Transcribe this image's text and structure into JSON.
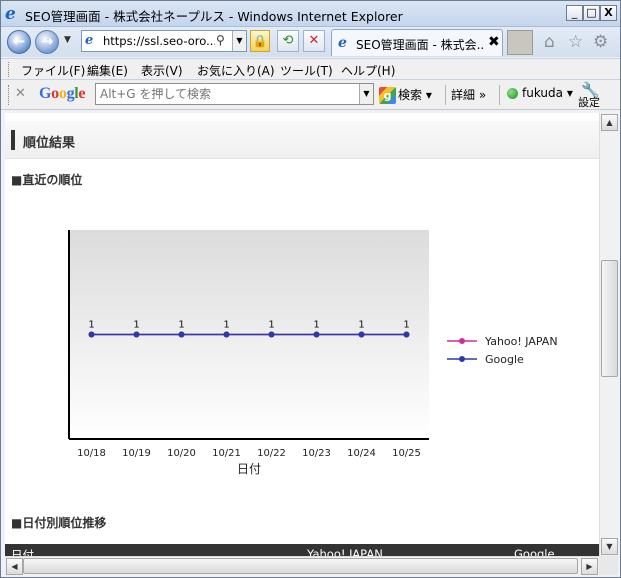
{
  "window": {
    "title": "SEO管理画面 - 株式会社ネープルス - Windows Internet Explorer",
    "min_label": "_",
    "max_label": "□",
    "close_label": "X"
  },
  "navbar": {
    "url": "https://ssl.seo-oro...",
    "tab_label": "SEO管理画面 - 株式会...",
    "tab_close": "✖"
  },
  "menubar": {
    "items": [
      "ファイル(F)",
      "編集(E)",
      "表示(V)",
      "お気に入り(A)",
      "ツール(T)",
      "ヘルプ(H)"
    ]
  },
  "google_toolbar": {
    "logo": "Google",
    "search_placeholder": "Alt+G を押して検索",
    "search_button": "検索",
    "more_button": "詳細 »",
    "user": "fukuda",
    "settings": "設定"
  },
  "page": {
    "section_title": "順位結果",
    "recent_rank_heading": "■直近の順位",
    "daily_rank_heading": "■日付別順位推移",
    "table_headers": [
      "日付",
      "Yahoo! JAPAN",
      "Google"
    ]
  },
  "chart_data": {
    "type": "line",
    "categories": [
      "10/18",
      "10/19",
      "10/20",
      "10/21",
      "10/22",
      "10/23",
      "10/24",
      "10/25"
    ],
    "series": [
      {
        "name": "Yahoo! JAPAN",
        "values": [
          1,
          1,
          1,
          1,
          1,
          1,
          1,
          1
        ],
        "color": "#cc2f9a"
      },
      {
        "name": "Google",
        "values": [
          1,
          1,
          1,
          1,
          1,
          1,
          1,
          1
        ],
        "color": "#2a3aa8"
      }
    ],
    "data_labels": [
      "1",
      "1",
      "1",
      "1",
      "1",
      "1",
      "1",
      "1"
    ],
    "xlabel": "日付",
    "ylabel": "",
    "title": "",
    "legend_position": "right",
    "grid": false
  }
}
